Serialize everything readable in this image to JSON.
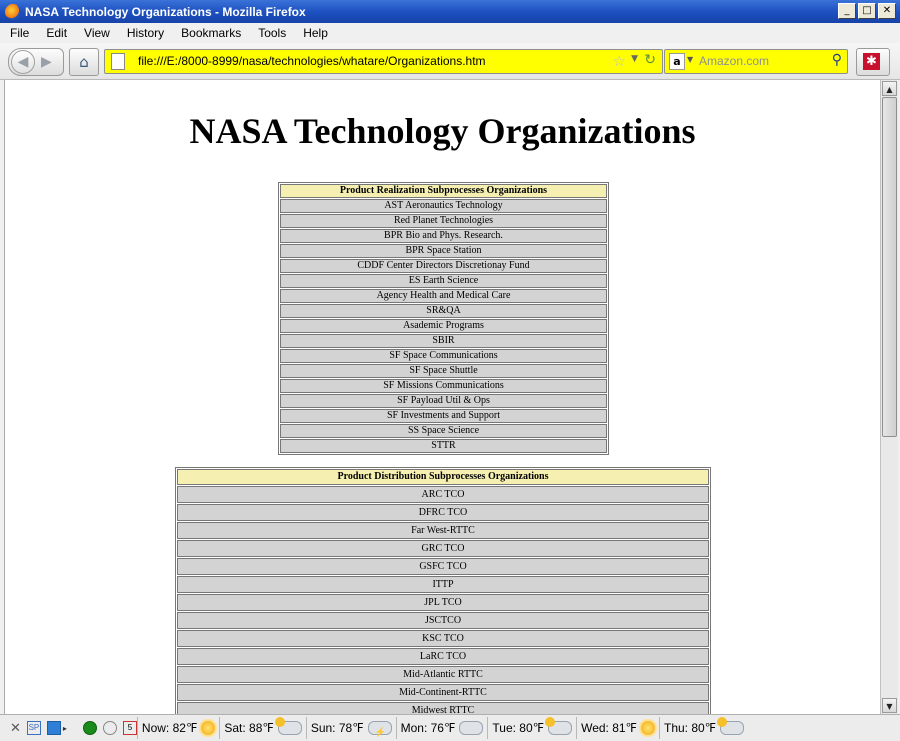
{
  "window": {
    "title": "NASA Technology Organizations - Mozilla Firefox",
    "controls": {
      "minimize": "_",
      "maximize": "□",
      "close": "✕"
    }
  },
  "menu": [
    "File",
    "Edit",
    "View",
    "History",
    "Bookmarks",
    "Tools",
    "Help"
  ],
  "navbar": {
    "back_icon": "back-arrow-icon",
    "forward_icon": "forward-arrow-icon",
    "home_icon": "home-icon",
    "url": "file:///E:/8000-8999/nasa/technologies/whatare/Organizations.htm",
    "search_engine": "a",
    "search_placeholder": "Amazon.com",
    "addon_glyph": "✱",
    "url_bar_color": "#ffff00"
  },
  "page": {
    "title": "NASA Technology Organizations",
    "table1": {
      "header": "Product Realization Subprocesses Organizations",
      "rows": [
        "AST Aeronautics Technology",
        "Red Planet Technologies",
        "BPR Bio and Phys. Research.",
        "BPR Space Station",
        "CDDF Center Directors Discretionay Fund",
        "ES Earth Science",
        "Agency Health and Medical Care",
        "SR&QA",
        "Asademic Programs",
        "SBIR",
        "SF Space Communications",
        "SF Space Shuttle",
        "SF Missions Communications",
        "SF Payload Util & Ops",
        "SF Investments and Support",
        "SS Space Science",
        "STTR"
      ]
    },
    "table2": {
      "header": "Product Distribution Subprocesses Organizations",
      "rows": [
        "ARC TCO",
        "DFRC TCO",
        "Far West-RTTC",
        "GRC TCO",
        "GSFC  TCO",
        "ITTP",
        "JPL TCO",
        "JSCTCO",
        "KSC  TCO",
        "LaRC  TCO",
        "Mid-Atlantic RTTC",
        "Mid-Continent-RTTC",
        "Midwest RTTC"
      ]
    }
  },
  "statusbar": {
    "close": "✕",
    "weather": [
      {
        "label": "Now: 82℉",
        "icon": "sun-icon"
      },
      {
        "label": "Sat: 88℉",
        "icon": "partly-cloudy-icon"
      },
      {
        "label": "Sun: 78℉",
        "icon": "thunderstorm-icon"
      },
      {
        "label": "Mon: 76℉",
        "icon": "cloudy-icon"
      },
      {
        "label": "Tue: 80℉",
        "icon": "partly-cloudy-icon"
      },
      {
        "label": "Wed: 81℉",
        "icon": "sun-icon"
      },
      {
        "label": "Thu: 80℉",
        "icon": "partly-cloudy-icon"
      }
    ],
    "calendar_day": "5"
  }
}
